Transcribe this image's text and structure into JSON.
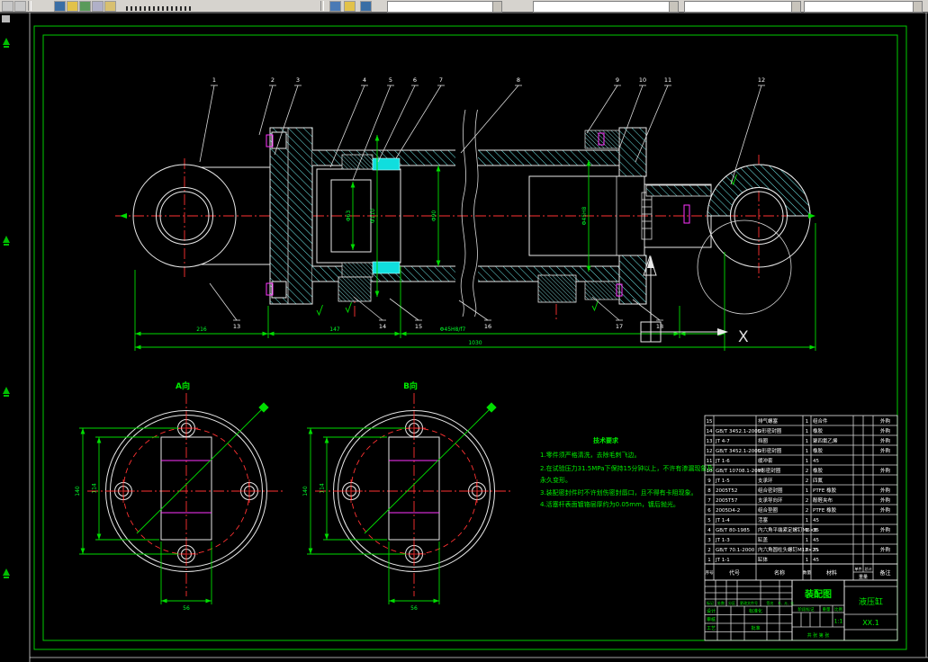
{
  "toolbar": {
    "icon_names": [
      "app-icon",
      "doc-icon",
      "annotate-icon",
      "layer-icon",
      "style-icon",
      "block-icon",
      "props-icon",
      "diamond-icon"
    ]
  },
  "drawing": {
    "views": {
      "a_label": "A向",
      "b_label": "B向"
    },
    "axis": {
      "x_label": "X"
    },
    "callouts_top": [
      "1",
      "2",
      "3",
      "4",
      "5",
      "6",
      "7",
      "8",
      "9",
      "10",
      "11",
      "12"
    ],
    "callouts_bottom": [
      "13",
      "14",
      "15",
      "16",
      "17",
      "18"
    ],
    "dims": {
      "chain": [
        "216",
        "147",
        "Φ45H8/f7"
      ],
      "overall": "1030",
      "body": [
        "Φ63",
        "Φ110",
        "Φ90",
        "Φ45H8"
      ],
      "flange": {
        "bolt_circle": "140",
        "rect_height": "114",
        "rect_width": "56"
      }
    },
    "tech": {
      "title": "技术要求",
      "lines": [
        "1.零件须严格清洗，去除毛刺飞边。",
        "2.在试验压力31.5MPa下保持15分钟以上，不许有渗漏现象及",
        "永久变形。",
        "3.装配密封件时不许划伤密封唇口，且不得有卡阻现象。",
        "4.活塞杆表面镀铬层厚约为0.05mm，镀后抛光。"
      ]
    },
    "bom": {
      "headers": {
        "seq": "序号",
        "code": "代号",
        "name": "名称",
        "qty": "数量",
        "material": "材料",
        "weight": "重量",
        "unit": "单件",
        "total": "总计",
        "remark": "备注"
      },
      "rows": [
        {
          "seq": "15",
          "code": "",
          "name": "排气螺塞",
          "qty": "1",
          "material": "组合件",
          "remark": "外购"
        },
        {
          "seq": "14",
          "code": "GB/T 3452.1-2005",
          "name": "O形密封圈",
          "qty": "1",
          "material": "橡胶",
          "remark": "外购"
        },
        {
          "seq": "13",
          "code": "JT 4-7",
          "name": "挡圈",
          "qty": "1",
          "material": "聚四氟乙烯",
          "remark": "外购"
        },
        {
          "seq": "12",
          "code": "GB/T 3452.1-2005",
          "name": "O形密封圈",
          "qty": "1",
          "material": "橡胶",
          "remark": "外购"
        },
        {
          "seq": "11",
          "code": "JT 1-6",
          "name": "缓冲套",
          "qty": "1",
          "material": "45",
          "remark": ""
        },
        {
          "seq": "10",
          "code": "GB/T 10708.1-2000",
          "name": "Y形密封圈",
          "qty": "2",
          "material": "橡胶",
          "remark": "外购"
        },
        {
          "seq": "9",
          "code": "JT 1-5",
          "name": "支承环",
          "qty": "2",
          "material": "四氟",
          "remark": ""
        },
        {
          "seq": "8",
          "code": "2005T52",
          "name": "组合密封圈",
          "qty": "1",
          "material": "PTFE 橡胶",
          "remark": "外购"
        },
        {
          "seq": "7",
          "code": "2005T57",
          "name": "支承导向环",
          "qty": "2",
          "material": "酚醛夹布",
          "remark": "外购"
        },
        {
          "seq": "6",
          "code": "2005D4-2",
          "name": "组合垫圈",
          "qty": "2",
          "material": "PTFE 橡胶",
          "remark": "外购"
        },
        {
          "seq": "5",
          "code": "JT 1-4",
          "name": "活塞",
          "qty": "1",
          "material": "45",
          "remark": ""
        },
        {
          "seq": "4",
          "code": "GB/T 80-1985",
          "name": "内六角平端紧定螺钉M6×8",
          "qty": "1",
          "material": "35",
          "remark": "外购"
        },
        {
          "seq": "3",
          "code": "JT 1-3",
          "name": "缸盖",
          "qty": "1",
          "material": "45",
          "remark": ""
        },
        {
          "seq": "2",
          "code": "GB/T 70.1-2000",
          "name": "内六角圆柱头螺钉M12×25",
          "qty": "8",
          "material": "35",
          "remark": "外购"
        },
        {
          "seq": "1",
          "code": "JT 1-1",
          "name": "缸体",
          "qty": "1",
          "material": "45",
          "remark": ""
        }
      ]
    },
    "title_block": {
      "drawing_name": "装配图",
      "product_name": "液压缸",
      "drawing_no": "XX.1",
      "scale_value": "1:1",
      "labels": {
        "mark": "标记",
        "count": "处数",
        "zone": "分区",
        "change_file": "更改文件号",
        "signature": "签名",
        "date": "年、月、日",
        "design": "设计",
        "standardize": "标准化",
        "audit": "审核",
        "process": "工艺",
        "approve": "批准",
        "stage": "阶段标记",
        "weight": "重量",
        "scale_label": "比例",
        "sheet": "共 张 第 张"
      }
    },
    "colors": {
      "frame": "#00cc00",
      "dimension": "#00ff2a",
      "centerline": "#ff3232",
      "hatch": "#6fe8e8",
      "outline": "#e9e9e9",
      "seal": "#ff35ff"
    }
  }
}
